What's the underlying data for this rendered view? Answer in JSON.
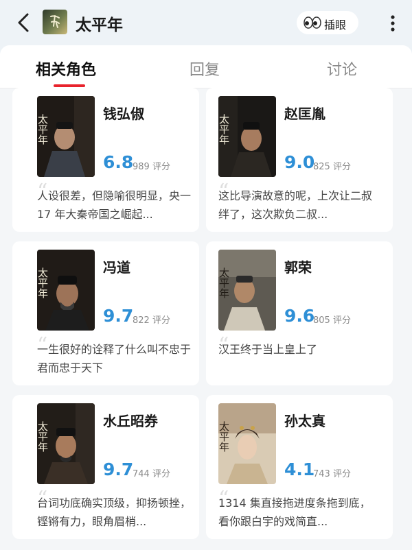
{
  "header": {
    "title": "太平年",
    "chip_label": "插眼"
  },
  "tabs": [
    {
      "label": "相关角色",
      "active": true
    },
    {
      "label": "回复",
      "active": false
    },
    {
      "label": "讨论",
      "active": false
    }
  ],
  "poster_title": "太平年",
  "cards": [
    {
      "name": "钱弘俶",
      "score": "6.8",
      "count": "989 评分",
      "review": "人设很差，但隐喻很明显，央一 17 年大秦帝国之崛起..."
    },
    {
      "name": "赵匡胤",
      "score": "9.0",
      "count": "825 评分",
      "review": "这比导演故意的呢，上次让二叔绊了，这次欺负二叔..."
    },
    {
      "name": "冯道",
      "score": "9.7",
      "count": "822 评分",
      "review": "一生很好的诠释了什么叫不忠于君而忠于天下"
    },
    {
      "name": "郭荣",
      "score": "9.6",
      "count": "805 评分",
      "review": "汉王终于当上皇上了"
    },
    {
      "name": "水丘昭券",
      "score": "9.7",
      "count": "744 评分",
      "review": "台词功底确实顶级，抑扬顿挫，铿锵有力，眼角眉梢..."
    },
    {
      "name": "孙太真",
      "score": "4.1",
      "count": "743 评分",
      "review": "1314 集直接拖进度条拖到底，看你跟白宇的戏简直..."
    }
  ],
  "colors": {
    "accent": "#e8232c",
    "score": "#2e8fd6",
    "page_bg": "#eef3f7"
  }
}
